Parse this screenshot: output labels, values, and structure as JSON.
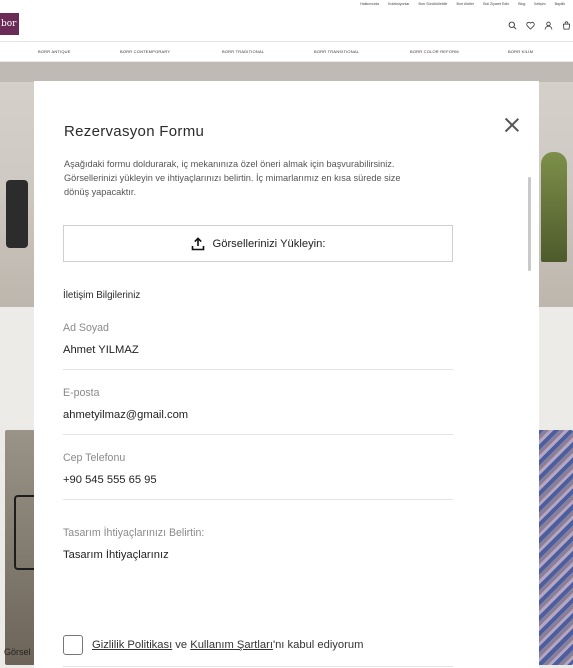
{
  "site": {
    "logo_text": "bor",
    "top_links": [
      "Hakkımızda",
      "Koleksiyonlar",
      "Borr Sürdürülebilir",
      "Borr Atelier",
      "Bizi Ziyaret Edin",
      "Blog",
      "İletişim",
      "Bayilik"
    ],
    "categories": [
      "BORR ANTIQUE",
      "BORR CONTEMPORARY",
      "BORR TRADITIONAL",
      "BORR TRANSITIONAL",
      "BORR COLOR REFORM",
      "BORR KİLİM"
    ],
    "bg_caption": "Görsel"
  },
  "modal": {
    "title": "Rezervasyon Formu",
    "description": "Aşağıdaki formu doldurarak, iç mekanınıza özel öneri almak için başvurabilirsiniz. Görsellerinizi yükleyin ve ihtiyaçlarınızı belirtin. İç mimarlarımız en kısa sürede size dönüş yapacaktır.",
    "upload_label": "Görsellerinizi Yükleyin:",
    "section_title": "İletişim Bilgileriniz",
    "fields": {
      "name": {
        "label": "Ad Soyad",
        "value": "Ahmet YILMAZ"
      },
      "email": {
        "label": "E-posta",
        "value": "ahmetyilmaz@gmail.com"
      },
      "phone": {
        "label": "Cep Telefonu",
        "value": "+90 545 555 65 95"
      },
      "needs": {
        "label": "Tasarım İhtiyaçlarınızı Belirtin:",
        "value": "Tasarım İhtiyaçlarınız"
      }
    },
    "consent": {
      "privacy_link": "Gizlilik Politikası",
      "conjunction": " ve ",
      "terms_link": "Kullanım Şartları",
      "suffix": "'nı kabul ediyorum"
    }
  },
  "colors": {
    "brand": "#6a2b57",
    "text": "#222222",
    "muted": "#8a8a8a",
    "border": "#cfcfcf"
  }
}
